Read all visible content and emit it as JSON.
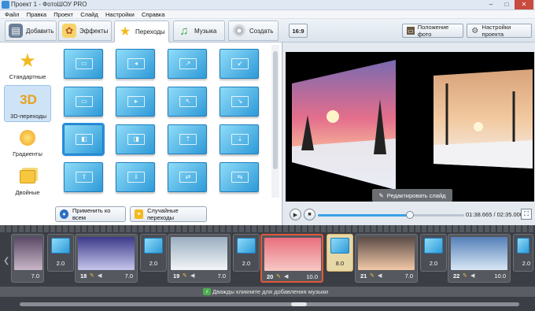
{
  "window": {
    "title": "Проект 1 - ФотоШОУ PRO",
    "minimize": "–",
    "maximize": "□",
    "close": "✕"
  },
  "menu": [
    "Файл",
    "Правка",
    "Проект",
    "Слайд",
    "Настройки",
    "Справка"
  ],
  "tabs": [
    {
      "label": "Добавить",
      "icon": "folder-icon",
      "color": "#6b7f96"
    },
    {
      "label": "Эффекты",
      "icon": "palette-icon",
      "color": "#e08a2a"
    },
    {
      "label": "Переходы",
      "icon": "star-icon",
      "color": "#f2b920",
      "active": true
    },
    {
      "label": "Музыка",
      "icon": "music-note-icon",
      "color": "#36a83a"
    },
    {
      "label": "Создать",
      "icon": "disc-icon",
      "color": "#8a8f96"
    }
  ],
  "toolbar": {
    "aspect": "16:9",
    "photo_position": "Положение фото",
    "project_settings": "Настройки проекта"
  },
  "categories": [
    {
      "label": "Стандартные",
      "icon": "star-icon",
      "selected": false
    },
    {
      "label": "3D-переходы",
      "icon": "3d-text-icon",
      "glyph": "3D",
      "selected": true
    },
    {
      "label": "Градиенты",
      "icon": "sun-gradient-icon",
      "selected": false
    },
    {
      "label": "Двойные",
      "icon": "double-cards-icon",
      "selected": false
    }
  ],
  "transition_glyphs": [
    "▭",
    "◂",
    "↗",
    "↙",
    "▭",
    "▸",
    "↖",
    "↘",
    "◧",
    "◨",
    "⇡",
    "⇣",
    "⇧",
    "⇩",
    "⇄",
    "⇆"
  ],
  "buttons": {
    "apply_all": "Применить ко всем",
    "random": "Случайные переходы"
  },
  "preview": {
    "edit_slide": "Редактировать слайд",
    "time": "01:38.665 / 02:35.000",
    "progress": 0.63
  },
  "timeline": {
    "slides": [
      {
        "num": "",
        "duration": "7.0",
        "colors": [
          "#5b4a66",
          "#c9b6c8"
        ]
      },
      {
        "num": "18",
        "duration": "7.0",
        "colors": [
          "#3d3a8a",
          "#c6c6ec"
        ]
      },
      {
        "num": "19",
        "duration": "7.0",
        "colors": [
          "#9aaec0",
          "#f3f5f8"
        ]
      },
      {
        "num": "20",
        "duration": "10.0",
        "colors": [
          "#e9707d",
          "#f6c8c5"
        ],
        "selected": true
      },
      {
        "num": "21",
        "duration": "7.0",
        "colors": [
          "#5c4c47",
          "#f2c9a8"
        ]
      },
      {
        "num": "22",
        "duration": "10.0",
        "colors": [
          "#5580b8",
          "#d8e7f5"
        ]
      }
    ],
    "transitions": [
      {
        "duration": "2.0"
      },
      {
        "duration": "2.0"
      },
      {
        "duration": "2.0"
      },
      {
        "duration": "8.0",
        "selected": true
      },
      {
        "duration": "2.0"
      },
      {
        "duration": "2.0"
      }
    ],
    "music_hint": "Дважды кликните для добавления музыки"
  }
}
